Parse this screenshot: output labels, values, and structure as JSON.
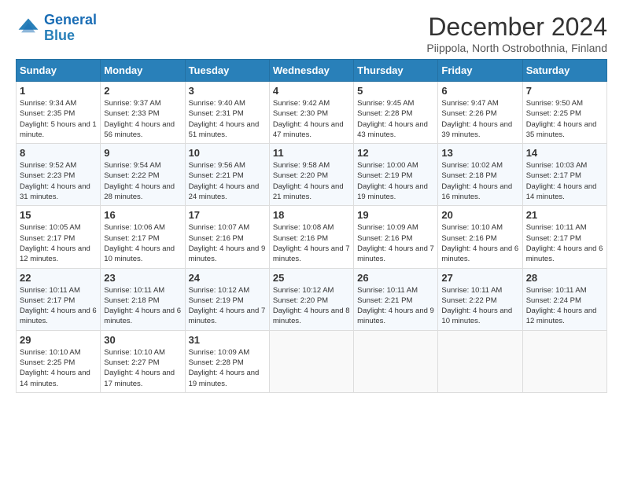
{
  "header": {
    "logo_line1": "General",
    "logo_line2": "Blue",
    "month_title": "December 2024",
    "location": "Piippola, North Ostrobothnia, Finland"
  },
  "weekdays": [
    "Sunday",
    "Monday",
    "Tuesday",
    "Wednesday",
    "Thursday",
    "Friday",
    "Saturday"
  ],
  "weeks": [
    [
      {
        "day": "1",
        "sunrise": "9:34 AM",
        "sunset": "2:35 PM",
        "daylight": "5 hours and 1 minute."
      },
      {
        "day": "2",
        "sunrise": "9:37 AM",
        "sunset": "2:33 PM",
        "daylight": "4 hours and 56 minutes."
      },
      {
        "day": "3",
        "sunrise": "9:40 AM",
        "sunset": "2:31 PM",
        "daylight": "4 hours and 51 minutes."
      },
      {
        "day": "4",
        "sunrise": "9:42 AM",
        "sunset": "2:30 PM",
        "daylight": "4 hours and 47 minutes."
      },
      {
        "day": "5",
        "sunrise": "9:45 AM",
        "sunset": "2:28 PM",
        "daylight": "4 hours and 43 minutes."
      },
      {
        "day": "6",
        "sunrise": "9:47 AM",
        "sunset": "2:26 PM",
        "daylight": "4 hours and 39 minutes."
      },
      {
        "day": "7",
        "sunrise": "9:50 AM",
        "sunset": "2:25 PM",
        "daylight": "4 hours and 35 minutes."
      }
    ],
    [
      {
        "day": "8",
        "sunrise": "9:52 AM",
        "sunset": "2:23 PM",
        "daylight": "4 hours and 31 minutes."
      },
      {
        "day": "9",
        "sunrise": "9:54 AM",
        "sunset": "2:22 PM",
        "daylight": "4 hours and 28 minutes."
      },
      {
        "day": "10",
        "sunrise": "9:56 AM",
        "sunset": "2:21 PM",
        "daylight": "4 hours and 24 minutes."
      },
      {
        "day": "11",
        "sunrise": "9:58 AM",
        "sunset": "2:20 PM",
        "daylight": "4 hours and 21 minutes."
      },
      {
        "day": "12",
        "sunrise": "10:00 AM",
        "sunset": "2:19 PM",
        "daylight": "4 hours and 19 minutes."
      },
      {
        "day": "13",
        "sunrise": "10:02 AM",
        "sunset": "2:18 PM",
        "daylight": "4 hours and 16 minutes."
      },
      {
        "day": "14",
        "sunrise": "10:03 AM",
        "sunset": "2:17 PM",
        "daylight": "4 hours and 14 minutes."
      }
    ],
    [
      {
        "day": "15",
        "sunrise": "10:05 AM",
        "sunset": "2:17 PM",
        "daylight": "4 hours and 12 minutes."
      },
      {
        "day": "16",
        "sunrise": "10:06 AM",
        "sunset": "2:17 PM",
        "daylight": "4 hours and 10 minutes."
      },
      {
        "day": "17",
        "sunrise": "10:07 AM",
        "sunset": "2:16 PM",
        "daylight": "4 hours and 9 minutes."
      },
      {
        "day": "18",
        "sunrise": "10:08 AM",
        "sunset": "2:16 PM",
        "daylight": "4 hours and 7 minutes."
      },
      {
        "day": "19",
        "sunrise": "10:09 AM",
        "sunset": "2:16 PM",
        "daylight": "4 hours and 7 minutes."
      },
      {
        "day": "20",
        "sunrise": "10:10 AM",
        "sunset": "2:16 PM",
        "daylight": "4 hours and 6 minutes."
      },
      {
        "day": "21",
        "sunrise": "10:11 AM",
        "sunset": "2:17 PM",
        "daylight": "4 hours and 6 minutes."
      }
    ],
    [
      {
        "day": "22",
        "sunrise": "10:11 AM",
        "sunset": "2:17 PM",
        "daylight": "4 hours and 6 minutes."
      },
      {
        "day": "23",
        "sunrise": "10:11 AM",
        "sunset": "2:18 PM",
        "daylight": "4 hours and 6 minutes."
      },
      {
        "day": "24",
        "sunrise": "10:12 AM",
        "sunset": "2:19 PM",
        "daylight": "4 hours and 7 minutes."
      },
      {
        "day": "25",
        "sunrise": "10:12 AM",
        "sunset": "2:20 PM",
        "daylight": "4 hours and 8 minutes."
      },
      {
        "day": "26",
        "sunrise": "10:11 AM",
        "sunset": "2:21 PM",
        "daylight": "4 hours and 9 minutes."
      },
      {
        "day": "27",
        "sunrise": "10:11 AM",
        "sunset": "2:22 PM",
        "daylight": "4 hours and 10 minutes."
      },
      {
        "day": "28",
        "sunrise": "10:11 AM",
        "sunset": "2:24 PM",
        "daylight": "4 hours and 12 minutes."
      }
    ],
    [
      {
        "day": "29",
        "sunrise": "10:10 AM",
        "sunset": "2:25 PM",
        "daylight": "4 hours and 14 minutes."
      },
      {
        "day": "30",
        "sunrise": "10:10 AM",
        "sunset": "2:27 PM",
        "daylight": "4 hours and 17 minutes."
      },
      {
        "day": "31",
        "sunrise": "10:09 AM",
        "sunset": "2:28 PM",
        "daylight": "4 hours and 19 minutes."
      },
      null,
      null,
      null,
      null
    ]
  ],
  "labels": {
    "sunrise_prefix": "Sunrise: ",
    "sunset_prefix": "Sunset: ",
    "daylight_prefix": "Daylight: "
  }
}
